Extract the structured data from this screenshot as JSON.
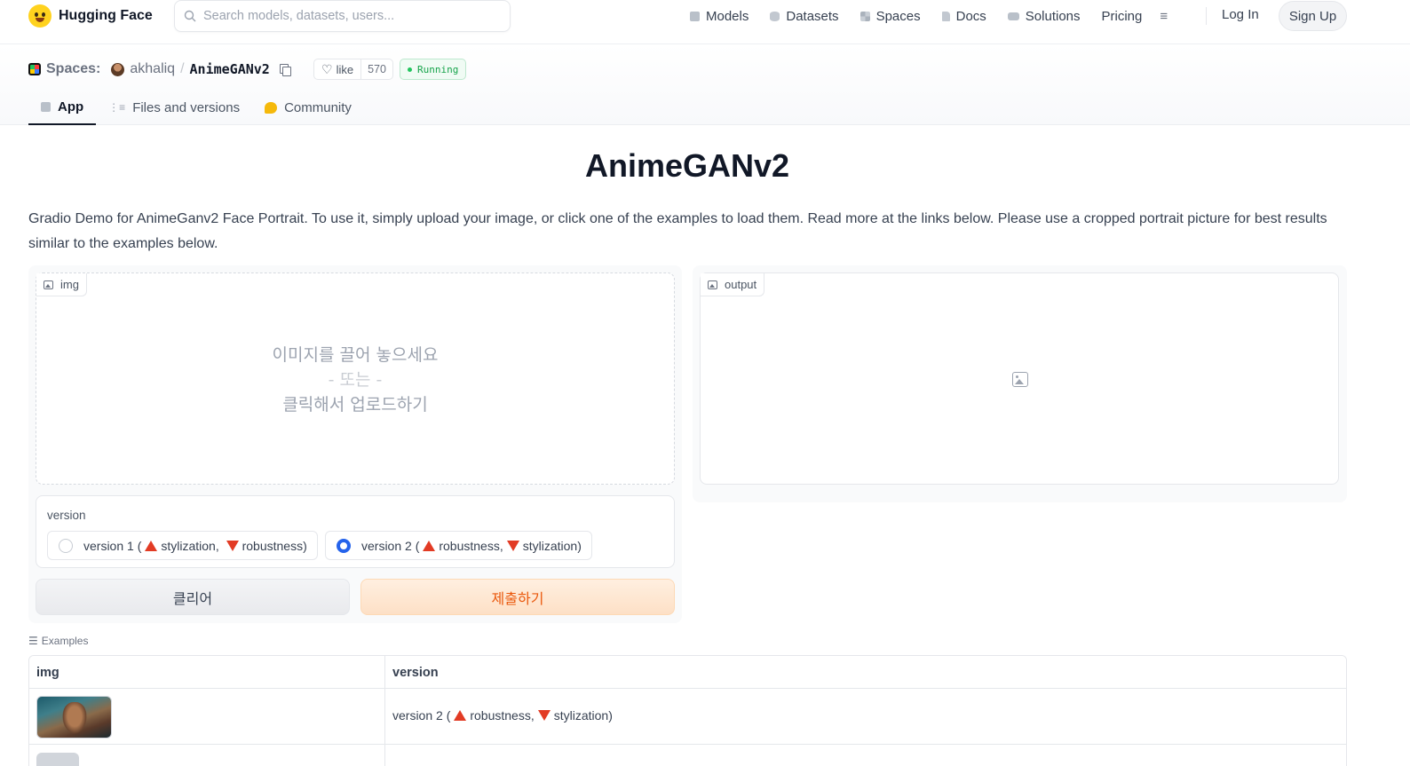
{
  "brand": {
    "name": "Hugging Face"
  },
  "search": {
    "placeholder": "Search models, datasets, users..."
  },
  "nav": {
    "items": [
      {
        "label": "Models",
        "icon": "cube-icon"
      },
      {
        "label": "Datasets",
        "icon": "database-icon"
      },
      {
        "label": "Spaces",
        "icon": "grid-icon"
      },
      {
        "label": "Docs",
        "icon": "doc-icon"
      },
      {
        "label": "Solutions",
        "icon": "briefcase-icon"
      },
      {
        "label": "Pricing",
        "icon": ""
      }
    ],
    "menu_icon": "≡",
    "login": "Log In",
    "signup": "Sign Up"
  },
  "space": {
    "section_label": "Spaces:",
    "owner": "akhaliq",
    "separator": "/",
    "repo": "AnimeGANv2",
    "like_label": "like",
    "like_count": "570",
    "status": "Running",
    "status_color": "#16a34a"
  },
  "tabs": [
    {
      "label": "App",
      "active": true
    },
    {
      "label": "Files and versions",
      "active": false
    },
    {
      "label": "Community",
      "active": false
    }
  ],
  "main": {
    "title": "AnimeGANv2",
    "description": "Gradio Demo for AnimeGanv2 Face Portrait. To use it, simply upload your image, or click one of the examples to load them. Read more at the links below. Please use a cropped portrait picture for best results similar to the examples below."
  },
  "input_image": {
    "label": "img",
    "drop_line1": "이미지를 끌어 놓으세요",
    "drop_line2": "- 또는 -",
    "drop_line3": "클릭해서 업로드하기"
  },
  "output_image": {
    "label": "output"
  },
  "version": {
    "label": "version",
    "options": [
      {
        "prefix": "version 1 (",
        "part1": "stylization,",
        "part2": "robustness)",
        "selected": false
      },
      {
        "prefix": "version 2 (",
        "part1": "robustness,",
        "part2": "stylization)",
        "selected": true
      }
    ]
  },
  "buttons": {
    "clear": "클리어",
    "submit": "제출하기",
    "accent": "#ea580c"
  },
  "examples": {
    "label": "Examples",
    "headers": [
      "img",
      "version"
    ],
    "rows": [
      {
        "version_prefix": "version 2 (",
        "part1": "robustness,",
        "part2": "stylization)"
      }
    ]
  }
}
